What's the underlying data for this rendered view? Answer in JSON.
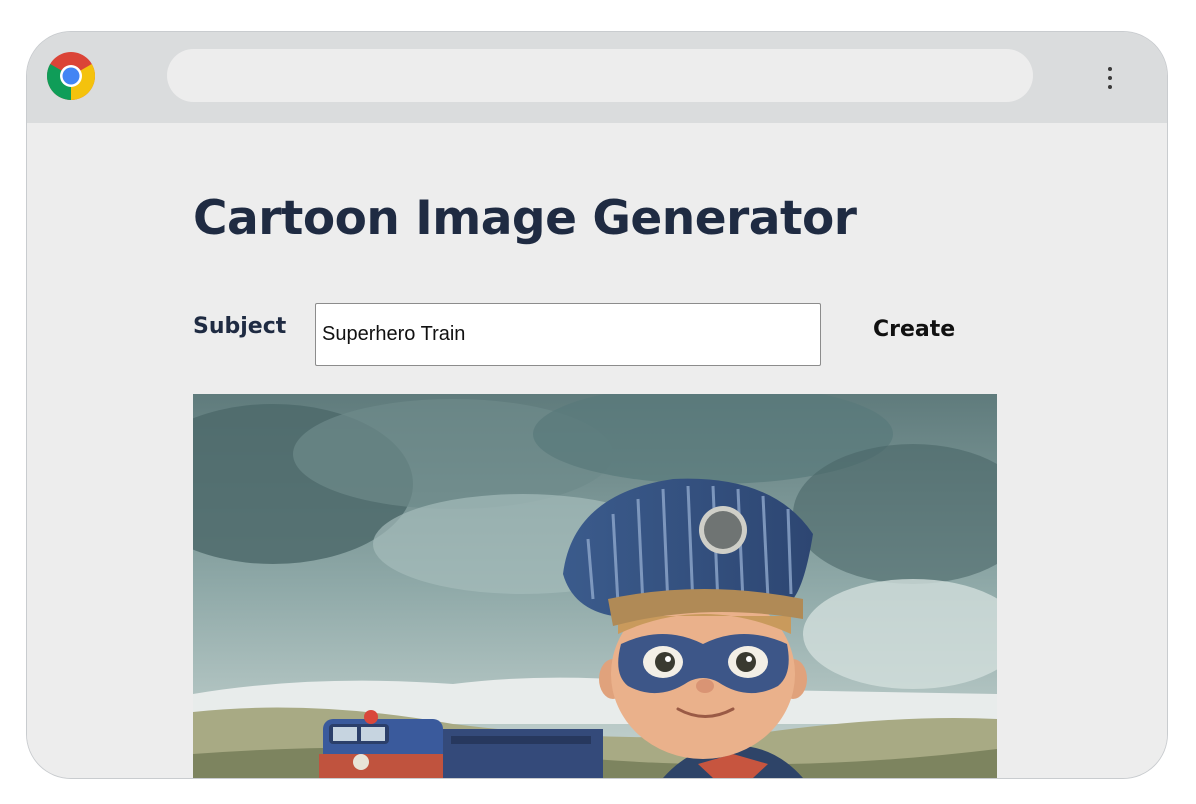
{
  "browser": {
    "logo_icon": "chrome-logo-icon",
    "address": "",
    "menu_icon": "kebab-menu-icon"
  },
  "page": {
    "title": "Cartoon Image Generator",
    "subject_label": "Subject",
    "subject_value": "Superhero Train",
    "create_label": "Create",
    "image_alt": "cartoon superhero train conductor with a locomotive"
  },
  "colors": {
    "title": "#1f2b42",
    "page_bg": "#ededed",
    "chrome_bar": "#dadcdd"
  }
}
